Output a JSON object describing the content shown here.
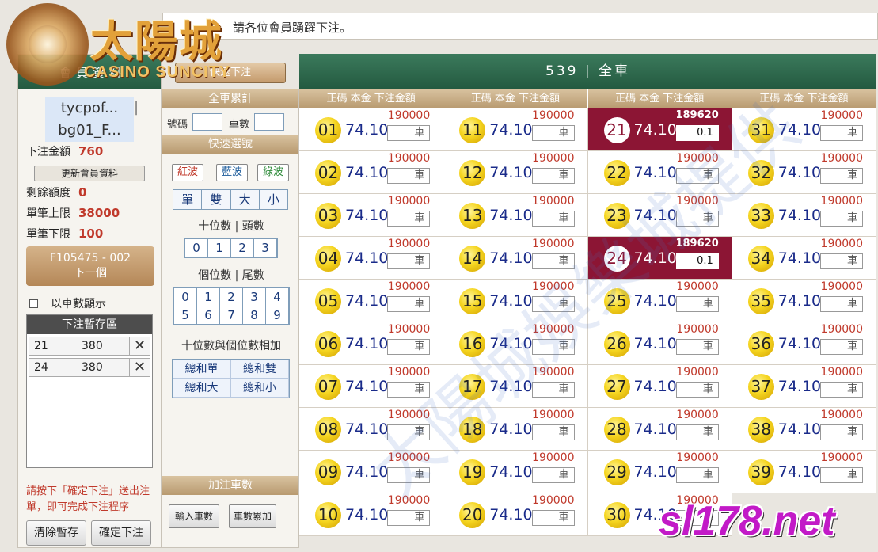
{
  "marquee": {
    "text": "請各位會員踴躍下注。"
  },
  "logo": {
    "cn_text": "太陽城",
    "en_text": "CASINO SUNCITY"
  },
  "left": {
    "header_label": "會員資料",
    "quick_bet_label": "快速下注",
    "user_line1": "tycpof...",
    "user_line2": "bg01_F...",
    "user_sep": "|",
    "bet_total_label": "下注金額",
    "bet_total_value": "760",
    "update_label": "更新會員資料",
    "balance_label": "剩餘額度",
    "balance_value": "0",
    "max_label": "單筆上限",
    "max_value": "38000",
    "min_label": "單筆下限",
    "min_value": "100",
    "next_line1": "F105475 - 002",
    "next_line2": "下一個",
    "chk_label": "以車數顯示",
    "temp_title": "下注暫存區",
    "temp_rows": [
      {
        "num": "21",
        "amt": "380"
      },
      {
        "num": "24",
        "amt": "380"
      }
    ],
    "delete_glyph": "✕",
    "note": "請按下「確定下注」送出注單，即可完成下注程序",
    "clear_label": "清除暫存",
    "confirm_label": "確定下注"
  },
  "mid": {
    "title": "全車累計",
    "num_label": "號碼",
    "count_label": "車數",
    "quick_title": "快速選號",
    "waves": [
      "紅波",
      "藍波",
      "綠波"
    ],
    "wave_colors": [
      "#c0392b",
      "#1a5a9a",
      "#2e8b3a"
    ],
    "bs": [
      "單",
      "雙",
      "大",
      "小"
    ],
    "tens_label": "十位數 | 頭數",
    "tens": [
      "0",
      "1",
      "2",
      "3"
    ],
    "units_label": "個位數 | 尾數",
    "units": [
      "0",
      "1",
      "2",
      "3",
      "4",
      "5",
      "6",
      "7",
      "8",
      "9"
    ],
    "sum_label": "十位數與個位數相加",
    "sums": [
      "總和單",
      "總和雙",
      "總和大",
      "總和小"
    ],
    "add_title": "加注車數",
    "input_label": "輸入車數",
    "accum_label": "車數累加"
  },
  "main": {
    "header": "539 | 全車",
    "col_header": "正碼  本金  下注金額",
    "amt_placeholder": "車",
    "default_limit": "190000",
    "odds": "74.10",
    "selected_limit": "189620",
    "selected_amt": "0.1",
    "numbers": [
      "01",
      "11",
      "21",
      "31",
      "02",
      "12",
      "22",
      "32",
      "03",
      "13",
      "23",
      "33",
      "04",
      "14",
      "24",
      "34",
      "05",
      "15",
      "25",
      "35",
      "06",
      "16",
      "26",
      "36",
      "07",
      "17",
      "27",
      "37",
      "08",
      "18",
      "28",
      "38",
      "09",
      "19",
      "29",
      "39",
      "10",
      "20",
      "30"
    ],
    "selected": [
      "21",
      "24"
    ]
  },
  "watermark": "太陽城娛樂城提供",
  "brand": "sl178.net"
}
